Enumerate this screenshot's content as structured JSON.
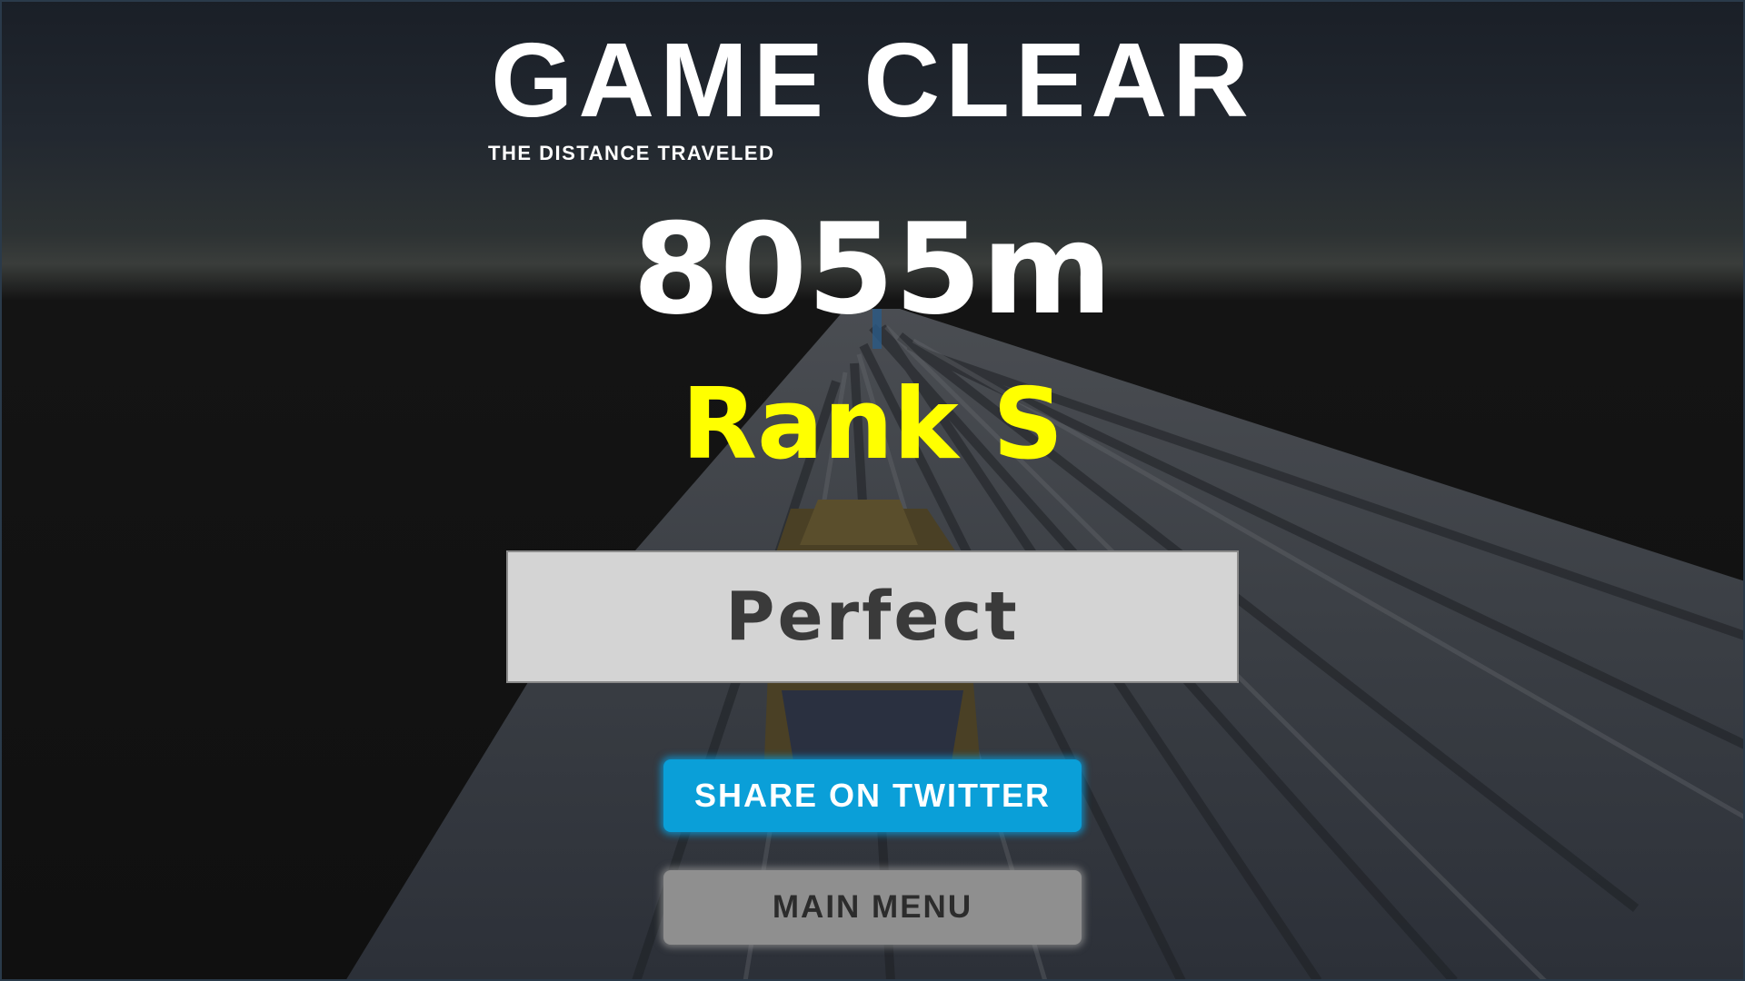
{
  "screen": {
    "title": "GAME CLEAR",
    "subtitle": "THE DISTANCE TRAVELED",
    "distance": "8055m",
    "rank": "Rank S",
    "grade": "Perfect"
  },
  "buttons": {
    "share_label": "SHARE ON TWITTER",
    "menu_label": "MAIN MENU"
  },
  "colors": {
    "title": "#ffffff",
    "rank": "#ffff00",
    "grade_box": "#d4d4d4",
    "share_button": "#0a9fd8",
    "menu_button": "#8f8f8f"
  }
}
